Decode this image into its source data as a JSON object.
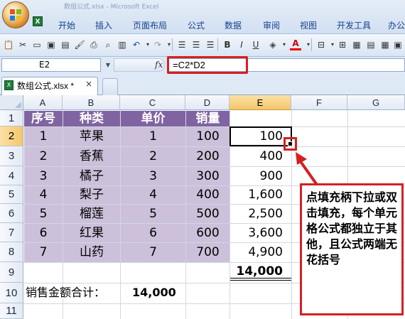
{
  "app": {
    "title_faded": "数组公式.xlsx - Microsoft Excel",
    "excel_icon": "X"
  },
  "ribbon": {
    "tabs": [
      "开始",
      "插入",
      "页面布局",
      "公式",
      "数据",
      "审阅",
      "视图",
      "开发工具",
      "办公"
    ]
  },
  "toolbar": {
    "icons": [
      "paste-icon",
      "cut-icon",
      "new-icon",
      "save-icon",
      "print-preview-icon",
      "format-painter-icon",
      "print-icon",
      "zoom-icon",
      "undo-icon",
      "redo-icon",
      "align-left-icon",
      "align-center-icon",
      "align-right-icon",
      "bold-icon",
      "italic-icon",
      "underline-icon",
      "fill-color-icon",
      "font-color-icon",
      "border-icon",
      "merge-icon",
      "wrap-icon"
    ],
    "font_color_letter": "A",
    "bold": "B",
    "italic": "I",
    "underline": "U"
  },
  "formula_bar": {
    "name_box": "E2",
    "fx": "fx",
    "formula": "=C2*D2"
  },
  "workbook_tab": {
    "label": "数组公式.xlsx *",
    "close": "×"
  },
  "columns": [
    "A",
    "B",
    "C",
    "D",
    "E",
    "F",
    "G"
  ],
  "rows": [
    "1",
    "2",
    "3",
    "4",
    "5",
    "6",
    "7",
    "8",
    "9",
    "10",
    "11"
  ],
  "table": {
    "headers": [
      "序号",
      "种类",
      "单价",
      "销量"
    ],
    "rows": [
      [
        "1",
        "苹果",
        "1",
        "100",
        "100"
      ],
      [
        "2",
        "香蕉",
        "2",
        "200",
        "400"
      ],
      [
        "3",
        "橘子",
        "3",
        "300",
        "900"
      ],
      [
        "4",
        "梨子",
        "4",
        "400",
        "1,600"
      ],
      [
        "5",
        "榴莲",
        "5",
        "500",
        "2,500"
      ],
      [
        "6",
        "红果",
        "6",
        "600",
        "3,600"
      ],
      [
        "7",
        "山药",
        "7",
        "700",
        "4,900"
      ]
    ],
    "total": "14,000"
  },
  "summary": {
    "label": "销售金额合计：",
    "value": "14,000"
  },
  "callout": {
    "text": "点填充柄下拉或双击填充，每个单元格公式都独立于其他，且公式两端无花括号"
  },
  "colors": {
    "header_fill": "#8064a2",
    "body_fill": "#ccc0da",
    "highlight": "#d42020",
    "selection_header": "#f4c66a"
  }
}
